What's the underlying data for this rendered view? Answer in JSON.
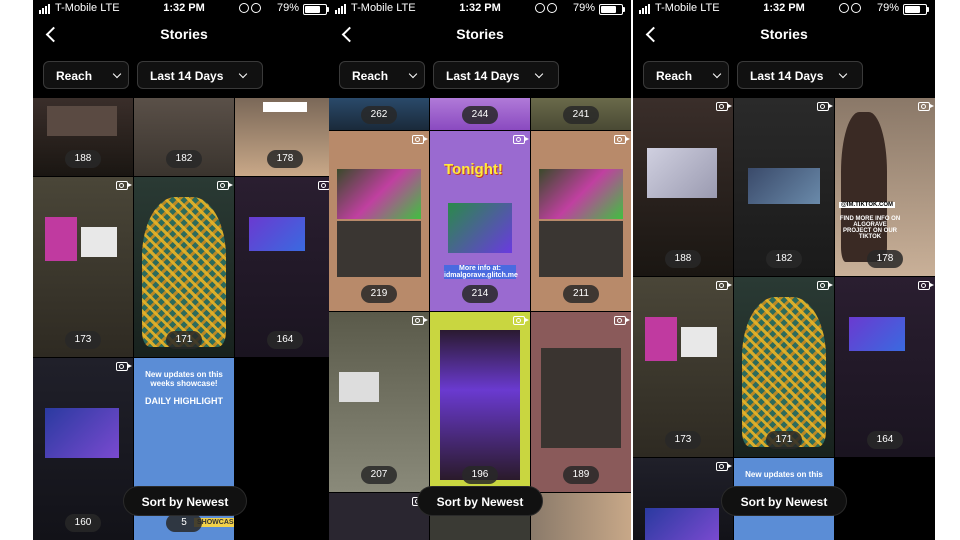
{
  "status": {
    "carrier": "T-Mobile  LTE",
    "time": "1:32 PM",
    "battery": "79%",
    "battery_level": 0.79
  },
  "header": {
    "title": "Stories"
  },
  "filters": {
    "metric": "Reach",
    "range": "Last 14 Days"
  },
  "sort_label": "Sort by Newest",
  "screens": [
    {
      "counts": [
        "188",
        "182",
        "178",
        "173",
        "171",
        "164",
        "160",
        "5"
      ],
      "updates_title": "New updates on this weeks showcase!",
      "updates_heading": "DAILY HIGHLIGHT",
      "updates_tag": "SHOWCASE"
    },
    {
      "counts": [
        "262",
        "244",
        "241",
        "219",
        "214",
        "211",
        "207",
        "196",
        "189"
      ],
      "tonight": "Tonight!",
      "more_info": "More info at: idmalgorave.glitch.me"
    },
    {
      "counts": [
        "188",
        "182",
        "178",
        "173",
        "171",
        "164"
      ],
      "updates_title": "New updates on this",
      "find_more": "FIND MORE INFO ON ALGORAVE PROJECT ON OUR TIKTOK",
      "handle": "@IM.TIKTOK.COM"
    }
  ]
}
